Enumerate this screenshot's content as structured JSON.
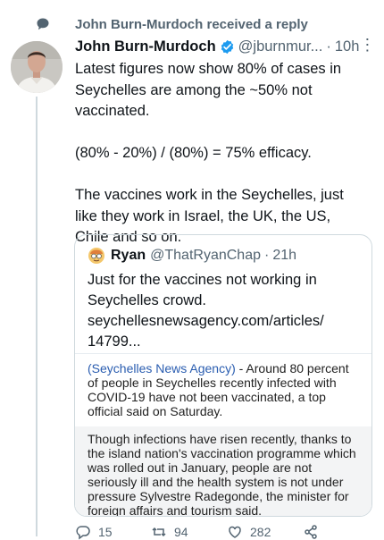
{
  "context": {
    "text": "John Burn-Murdoch received a reply"
  },
  "tweet": {
    "name": "John Burn-Murdoch",
    "handle": "@jburnmur...",
    "separator": "·",
    "time": "10h",
    "more": "⋮",
    "text": "Latest figures now show 80% of cases in Seychelles are among the ~50% not vaccinated.\n\n(80% - 20%) / (80%) = 75% efficacy.\n\nThe vaccines work in the Seychelles, just like they work in Israel, the UK, the US, Chile and so on."
  },
  "quote": {
    "name": "Ryan",
    "handle": "@ThatRyanChap",
    "separator": "·",
    "time": "21h",
    "lines": [
      "Just for the vaccines not working in",
      "Seychelles crowd.",
      "seychellesnewsagency.com/articles/",
      "14799..."
    ],
    "card": {
      "source": "(Seychelles News Agency)",
      "para1_rest": " - Around 80 percent of people in Seychelles recently infected with COVID-19 have not been vaccinated, a top official said on Saturday.",
      "para2": "Though infections have risen recently, thanks to the island nation's vaccination programme which was rolled out in January, people are not seriously ill and the health system is not under pressure Sylvestre Radegonde, the minister for foreign affairs and tourism said."
    }
  },
  "actions": {
    "replies": "15",
    "retweets": "94",
    "likes": "282"
  },
  "colors": {
    "verified": "#1d9bf0",
    "secondary_text": "#536471",
    "border": "#cfd9de",
    "link": "#2a5db0"
  }
}
